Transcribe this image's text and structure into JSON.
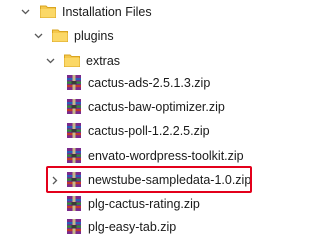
{
  "tree": {
    "installation_files": {
      "label": "Installation Files",
      "expanded": true,
      "icon": "folder-icon"
    },
    "plugins": {
      "label": "plugins",
      "expanded": true,
      "icon": "folder-icon"
    },
    "extras": {
      "label": "extras",
      "expanded": true,
      "icon": "folder-icon"
    },
    "files": [
      {
        "label": "cactus-ads-2.5.1.3.zip",
        "icon": "zip-archive-icon"
      },
      {
        "label": "cactus-baw-optimizer.zip",
        "icon": "zip-archive-icon"
      },
      {
        "label": "cactus-poll-1.2.2.5.zip",
        "icon": "zip-archive-icon"
      },
      {
        "label": "envato-wordpress-toolkit.zip",
        "icon": "zip-archive-icon"
      },
      {
        "label": "newstube-sampledata-1.0.zip",
        "icon": "zip-archive-icon",
        "highlighted": true,
        "highlight_color": "#e3001b"
      },
      {
        "label": "plg-cactus-rating.zip",
        "icon": "zip-archive-icon"
      },
      {
        "label": "plg-easy-tab.zip",
        "icon": "zip-archive-icon"
      }
    ]
  },
  "colors": {
    "folder": "#f5c84c",
    "highlight": "#e3001b",
    "expander": "#5a5a5a"
  }
}
